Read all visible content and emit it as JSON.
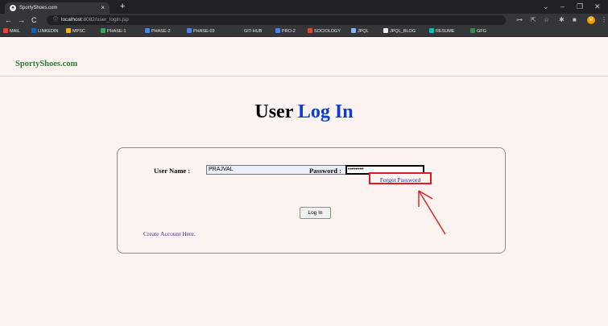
{
  "browser": {
    "tab_title": "SportyShoes.com",
    "tab_close": "×",
    "new_tab": "+",
    "url_host": "localhost",
    "url_rest": ":8082/user_login.jsp",
    "bookmarks": [
      {
        "label": "MAIL",
        "icon": "gmail-icon",
        "color": "#ea4335"
      },
      {
        "label": "LINKEDIN",
        "icon": "linkedin-icon",
        "color": "#0a66c2"
      },
      {
        "label": "MPSC",
        "icon": "mpsc-icon",
        "color": "#f4b400"
      },
      {
        "label": "PHASE-1",
        "icon": "drive-icon",
        "color": "#34a853"
      },
      {
        "label": "PHASE-2",
        "icon": "docs-icon",
        "color": "#4285f4"
      },
      {
        "label": "PHASE-03",
        "icon": "docs-icon",
        "color": "#4285f4"
      },
      {
        "label": "GIT-HUB",
        "icon": "github-icon",
        "color": "#35363a"
      },
      {
        "label": "PRO-2",
        "icon": "docs-icon",
        "color": "#4285f4"
      },
      {
        "label": "SOCIOLOGY",
        "icon": "sociology-icon",
        "color": "#ea4335"
      },
      {
        "label": "JPQL",
        "icon": "jpql-icon",
        "color": "#8ab4f8"
      },
      {
        "label": "JPQL_BLOG",
        "icon": "globe-icon",
        "color": "#e8eaed"
      },
      {
        "label": "RESUME",
        "icon": "resume-icon",
        "color": "#00c4b4"
      },
      {
        "label": "GFG",
        "icon": "gfg-icon",
        "color": "#2f8d46"
      }
    ]
  },
  "site": {
    "brand": "SportyShoes.com"
  },
  "login": {
    "title_part1": "User",
    "title_part2": "Log In",
    "username_label": "User Name :",
    "username_value": "PRAJVAL",
    "password_label": "Password :",
    "password_value": "••••••••",
    "forgot_link": "Forgot Password",
    "login_button": "Log In",
    "create_link": "Create Account Here."
  },
  "colors": {
    "page_bg": "#fdf4f2",
    "brand_green": "#2d7a32",
    "title_blue": "#0a3ed6",
    "highlight_red": "#e01b1b"
  }
}
